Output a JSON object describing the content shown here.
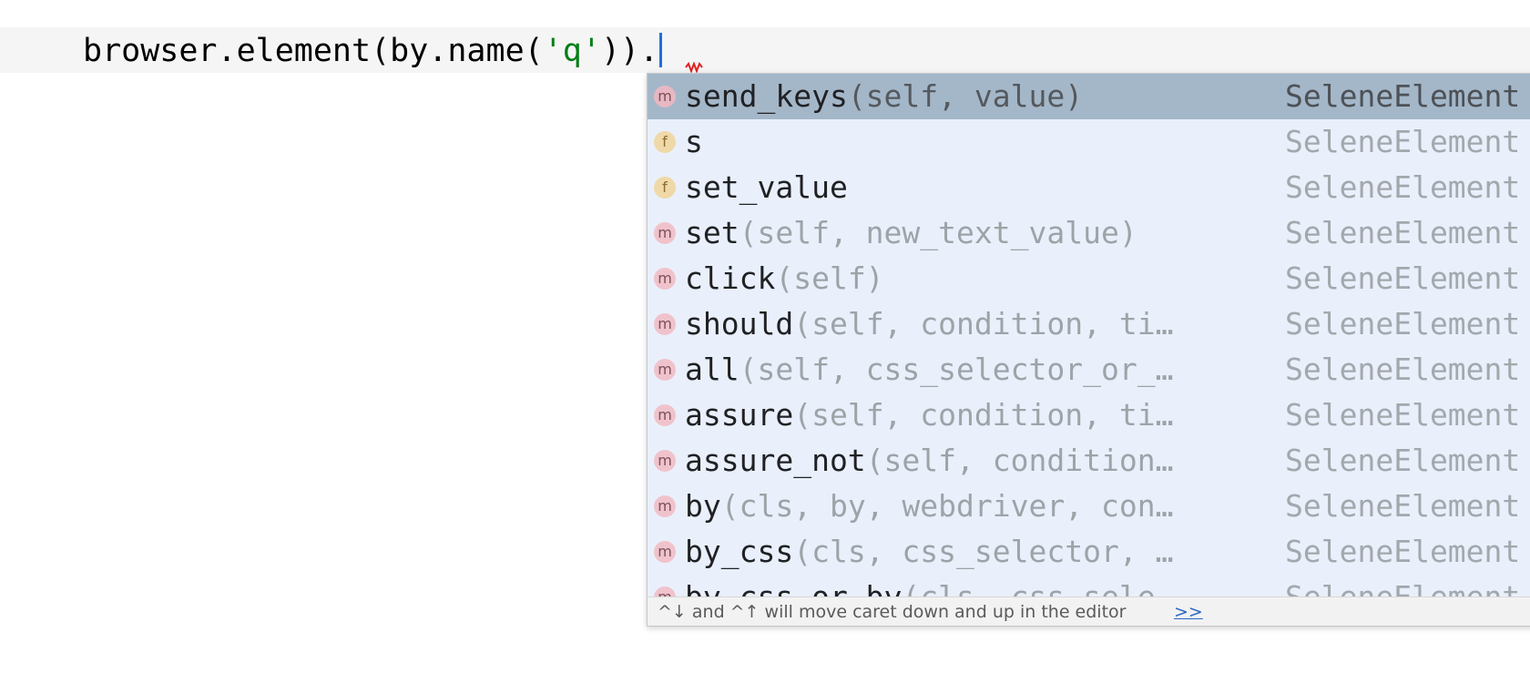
{
  "editor": {
    "code": {
      "prefix": "browser.element(by.name(",
      "string_literal": "'q'",
      "suffix": ")).",
      "string_color": "#067d17"
    },
    "caret_color": "#1f6fe0",
    "error_squiggle_color": "#e02020"
  },
  "completion_popup": {
    "items": [
      {
        "kind": "m",
        "name": "send_keys",
        "signature": "(self, value)",
        "type": "SeleneElement",
        "selected": true
      },
      {
        "kind": "f",
        "name": "s",
        "signature": "",
        "type": "SeleneElement",
        "selected": false
      },
      {
        "kind": "f",
        "name": "set_value",
        "signature": "",
        "type": "SeleneElement",
        "selected": false
      },
      {
        "kind": "m",
        "name": "set",
        "signature": "(self, new_text_value)",
        "type": "SeleneElement",
        "selected": false
      },
      {
        "kind": "m",
        "name": "click",
        "signature": "(self)",
        "type": "SeleneElement",
        "selected": false
      },
      {
        "kind": "m",
        "name": "should",
        "signature": "(self, condition, ti…",
        "type": "SeleneElement",
        "selected": false
      },
      {
        "kind": "m",
        "name": "all",
        "signature": "(self, css_selector_or_…",
        "type": "SeleneElement",
        "selected": false
      },
      {
        "kind": "m",
        "name": "assure",
        "signature": "(self, condition, ti…",
        "type": "SeleneElement",
        "selected": false
      },
      {
        "kind": "m",
        "name": "assure_not",
        "signature": "(self, condition…",
        "type": "SeleneElement",
        "selected": false
      },
      {
        "kind": "m",
        "name": "by",
        "signature": "(cls, by, webdriver, con…",
        "type": "SeleneElement",
        "selected": false
      },
      {
        "kind": "m",
        "name": "by_css",
        "signature": "(cls, css_selector, …",
        "type": "SeleneElement",
        "selected": false
      },
      {
        "kind": "m",
        "name": "by_css_or_by",
        "signature": "(cls, css_sele…",
        "type": "SeleneElement",
        "selected": false
      }
    ],
    "footer": {
      "hint": "^↓ and ^↑ will move caret down and up in the editor",
      "link": ">>"
    },
    "colors": {
      "background": "#e9f0fb",
      "selected_background": "#a4b7c9",
      "method_badge": "#f0c3cc",
      "field_badge": "#efd9a8"
    }
  }
}
